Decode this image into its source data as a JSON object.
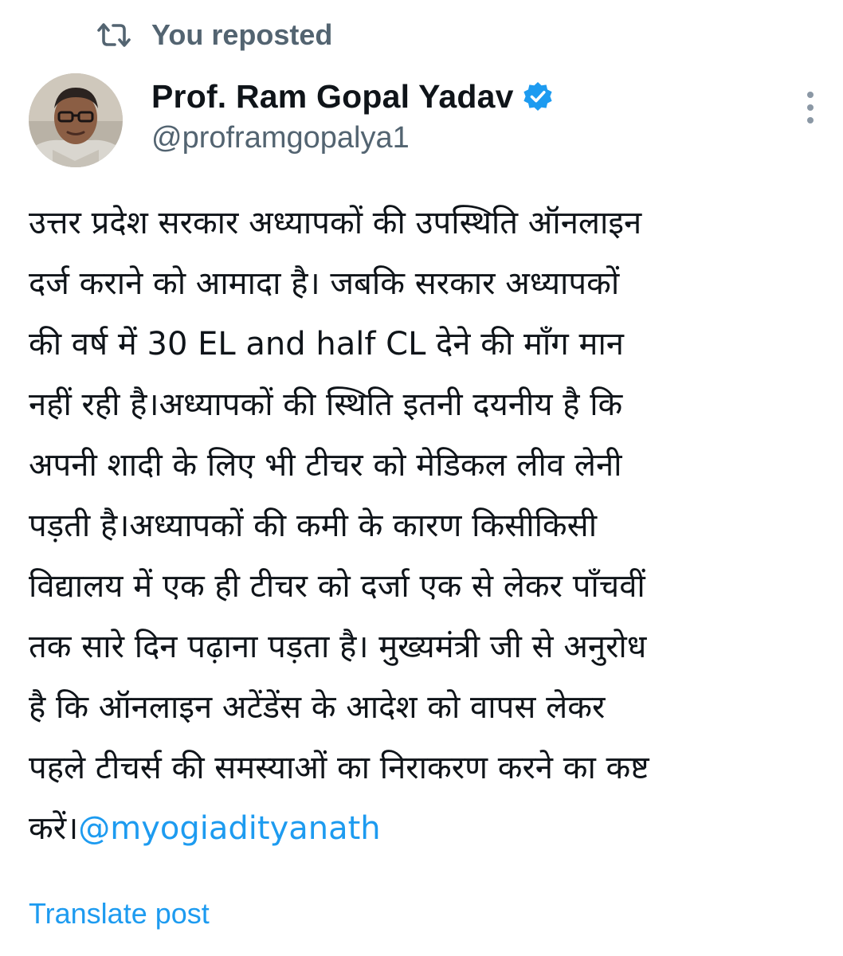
{
  "repost": {
    "label": "You reposted",
    "icon": "repost-icon"
  },
  "author": {
    "name": "Prof. Ram Gopal Yadav",
    "handle": "@proframgopalya1",
    "verified_icon": "verified-badge-icon",
    "avatar": "avatar"
  },
  "post": {
    "lines": [
      "उत्तर प्रदेश सरकार अध्यापकों की उपस्थिति ऑनलाइन",
      "दर्ज कराने को आमादा है। जबकि सरकार अध्यापकों",
      "की वर्ष में 30 EL and half CL देने की माँग मान",
      "नहीं रही है।अध्यापकों की स्थिति इतनी दयनीय है कि",
      "अपनी शादी के लिए भी टीचर को मेडिकल लीव लेनी",
      "पड़ती है।अध्यापकों की  कमी के कारण किसीकिसी",
      "विद्यालय में एक ही टीचर को दर्जा एक से लेकर पाँचवीं",
      "तक सारे दिन पढ़ाना पड़ता है। मुख्यमंत्री जी से अनुरोध",
      "है कि ऑनलाइन अटेंडेंस के आदेश को वापस लेकर",
      "पहले टीचर्स की समस्याओं का निराकरण करने का कष्ट"
    ],
    "last_line_prefix": "करें।",
    "mention": "@myogiadityanath"
  },
  "actions": {
    "translate_label": "Translate post",
    "more_icon": "more-vertical-icon"
  },
  "colors": {
    "text_primary": "#0f1419",
    "text_secondary": "#536471",
    "link": "#1d9bf0",
    "background": "#ffffff"
  }
}
